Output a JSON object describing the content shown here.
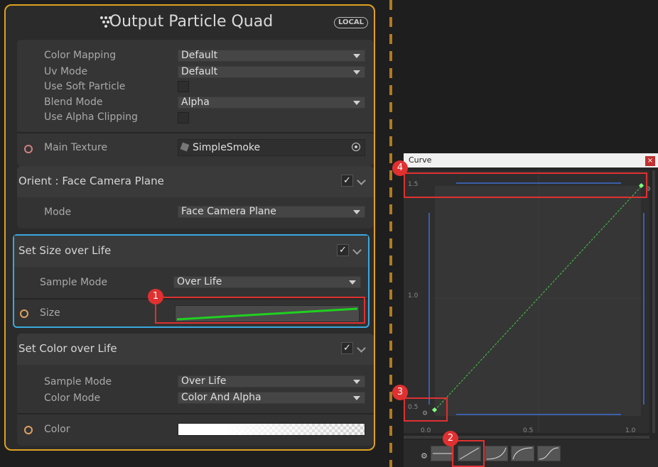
{
  "node": {
    "title": "Output Particle Quad",
    "badge": "LOCAL",
    "accent_color": "#e0a020",
    "icon": "vfx-dots-icon",
    "output_settings": {
      "color_mapping": {
        "label": "Color Mapping",
        "value": "Default"
      },
      "uv_mode": {
        "label": "Uv Mode",
        "value": "Default"
      },
      "soft_particle": {
        "label": "Use Soft Particle",
        "checked": false
      },
      "blend_mode": {
        "label": "Blend Mode",
        "value": "Alpha"
      },
      "alpha_clipping": {
        "label": "Use Alpha Clipping",
        "checked": false
      }
    },
    "main_texture": {
      "label": "Main Texture",
      "value": "SimpleSmoke",
      "icon": "texture-icon",
      "picker_icon": "object-picker-icon"
    },
    "blocks": [
      {
        "title": "Orient : Face Camera Plane",
        "enabled": true,
        "fields": [
          {
            "label": "Mode",
            "value": "Face Camera Plane"
          }
        ]
      },
      {
        "title": "Set Size over Life",
        "enabled": true,
        "selected": true,
        "fields": [
          {
            "label": "Sample Mode",
            "value": "Over Life"
          },
          {
            "label": "Size"
          }
        ]
      },
      {
        "title": "Set Color over Life",
        "enabled": true,
        "fields": [
          {
            "label": "Sample Mode",
            "value": "Over Life"
          },
          {
            "label": "Color Mode",
            "value": "Color And Alpha"
          },
          {
            "label": "Color"
          }
        ]
      }
    ],
    "selected_color": "#3aa8e0",
    "curve_color": "#20d020"
  },
  "curve_window": {
    "title": "Curve",
    "close_label": "×",
    "y_ticks": [
      "1.5",
      "1.0",
      "0.5"
    ],
    "x_ticks": [
      "0.0",
      "0.5",
      "1.0"
    ],
    "settings_icon": "gear-icon",
    "presets_count": 5
  },
  "annotations": [
    "1",
    "2",
    "3",
    "4"
  ],
  "annotation_color": "#e03030"
}
